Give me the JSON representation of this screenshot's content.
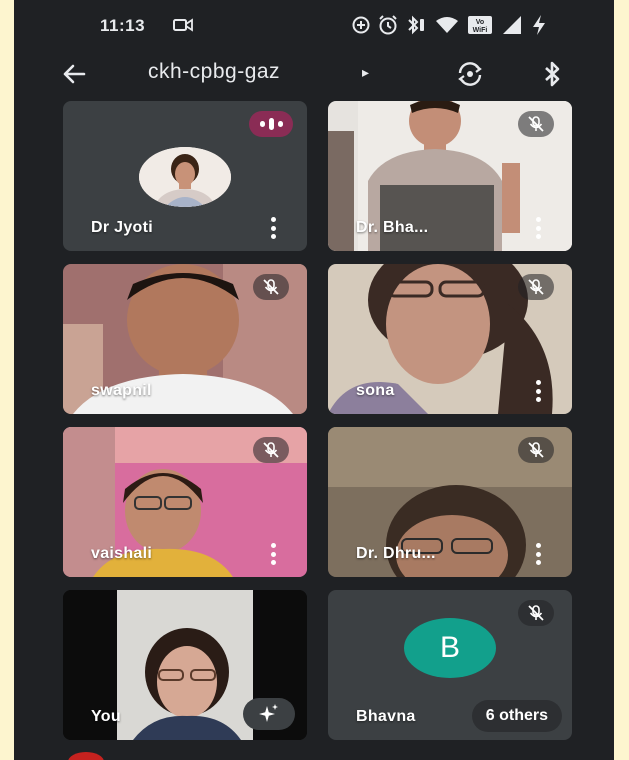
{
  "status_bar": {
    "time": "11:13",
    "wifi_label": "Vo\nWiFi"
  },
  "header": {
    "meeting_code": "ckh-cpbg-gaz",
    "caret": "▸"
  },
  "participants": [
    {
      "name": "Dr Jyoti",
      "muted": false,
      "speaking": true,
      "has_menu": true
    },
    {
      "name": "Dr. Bha...",
      "muted": true,
      "has_menu": true
    },
    {
      "name": "swapnil",
      "muted": true,
      "has_menu": false
    },
    {
      "name": "sona",
      "muted": true,
      "has_menu": true
    },
    {
      "name": "vaishali",
      "muted": true,
      "has_menu": true
    },
    {
      "name": "Dr. Dhru...",
      "muted": true,
      "has_menu": true
    },
    {
      "name": "You",
      "muted": false,
      "has_menu": false,
      "has_effects_button": true
    },
    {
      "name": "Bhavna",
      "avatar_letter": "B",
      "muted": true,
      "others_label": "6 others"
    }
  ],
  "colors": {
    "background": "#1f2124",
    "tile": "#3c4043",
    "speaking_indicator": "#8a2c55",
    "avatar_teal": "#12a08c",
    "outer_frame": "#fdf5cf"
  },
  "icons": {
    "back": "arrow-left-icon",
    "camera": "camera-icon",
    "switch_camera": "switch-camera-icon",
    "bluetooth": "bluetooth-icon",
    "mic_off": "mic-off-icon",
    "more": "more-vertical-icon",
    "effects": "sparkle-icon"
  }
}
